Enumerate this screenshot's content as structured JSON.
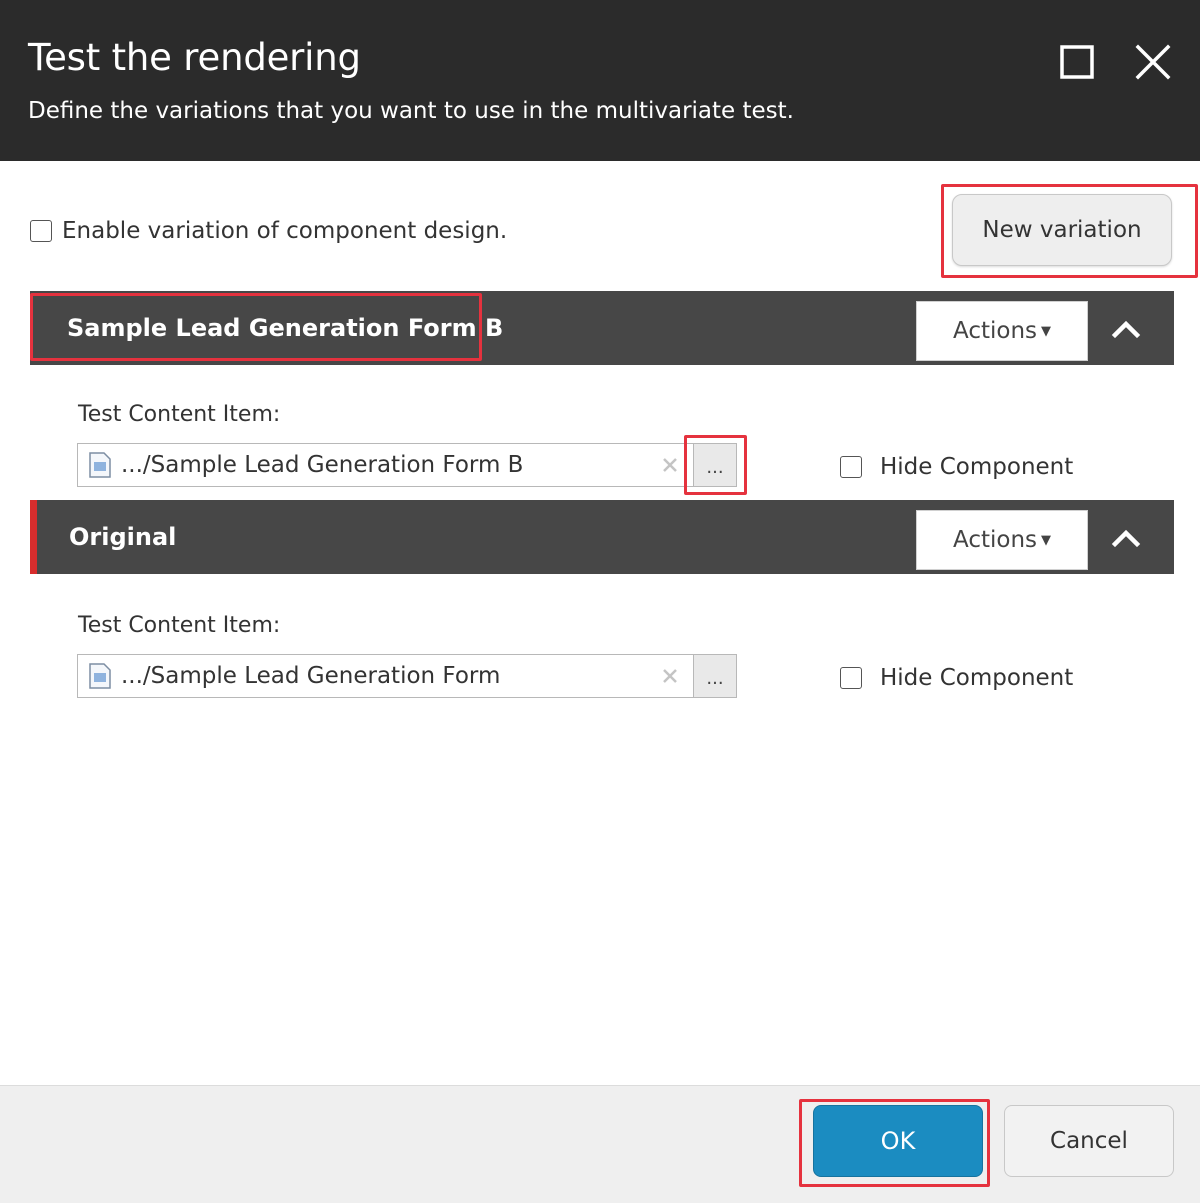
{
  "dialog": {
    "title": "Test the rendering",
    "subtitle": "Define the variations that you want to use in the multivariate test.",
    "maximize_icon": "maximize-icon",
    "close_icon": "close-icon"
  },
  "options": {
    "enable_design_label": "Enable variation of component design.",
    "enable_design_checked": false,
    "new_variation_label": "New variation"
  },
  "variations": [
    {
      "name": "Sample Lead Generation Form B",
      "actions_label": "Actions",
      "field_label": "Test Content Item:",
      "value": ".../Sample Lead Generation Form B",
      "browse_label": "...",
      "hide_label": "Hide Component",
      "hide_checked": false
    },
    {
      "name": "Original",
      "actions_label": "Actions",
      "field_label": "Test Content Item:",
      "value": ".../Sample Lead Generation Form",
      "browse_label": "...",
      "hide_label": "Hide Component",
      "hide_checked": false
    }
  ],
  "footer": {
    "ok_label": "OK",
    "cancel_label": "Cancel"
  },
  "colors": {
    "titlebar": "#2b2b2b",
    "variation_header": "#474747",
    "accent": "#d72d2d",
    "ok_button": "#1b8cc1",
    "highlight": "#e5323e"
  }
}
